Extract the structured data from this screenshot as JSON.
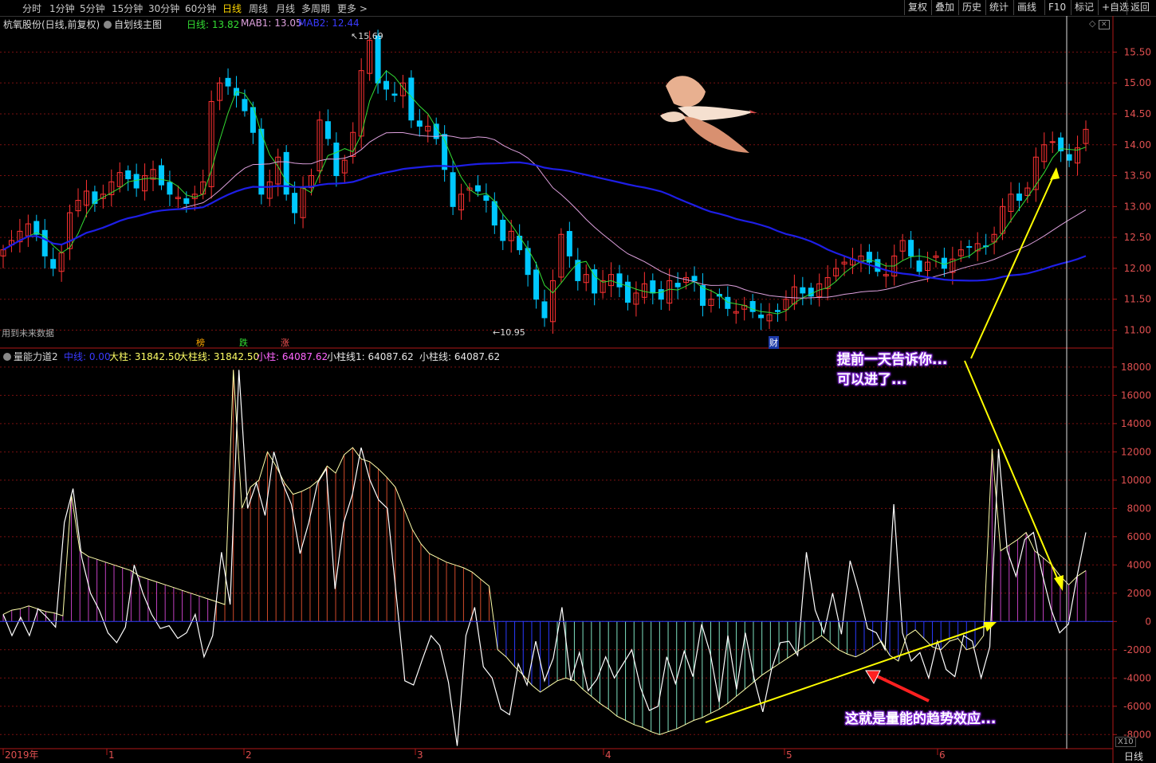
{
  "toolbar": {
    "periods": [
      "分时",
      "1分钟",
      "5分钟",
      "15分钟",
      "30分钟",
      "60分钟",
      "日线",
      "周线",
      "月线",
      "多周期",
      "更多 >"
    ],
    "active_period": "日线",
    "right_buttons": [
      "复权",
      "叠加",
      "历史",
      "统计",
      "画线",
      "F10",
      "标记",
      "+自选",
      "返回"
    ]
  },
  "main_info": {
    "stock": "杭氧股份(日线,前复权)",
    "indicator_name": "自划线主图",
    "day_label": "日线: 13.82",
    "mab1_label": "MAB1: 13.05",
    "mab2_label": "MAB2: 12.44"
  },
  "sub_info": {
    "name": "量能力道2",
    "zhongxian": "中线: 0.00",
    "dazhu": "大柱: 31842.50",
    "dazhuxian": "大柱线: 31842.50",
    "xiaozhu": "小柱: 64087.62",
    "xiaozhuxian1": "小柱线1: 64087.62",
    "xiaozhuxian": "小柱线: 64087.62"
  },
  "labels": {
    "future_data": "用到未来数据",
    "high_mark": "15.69",
    "low_mark": "10.95",
    "tag_bang": "榜",
    "tag_die": "跌",
    "tag_zhang": "涨",
    "tag_cai": "财",
    "x10": "X10",
    "bottom_period": "日线",
    "annotation_top_1": "提前一天告诉你...",
    "annotation_top_2": "可以进了...",
    "annotation_bottom": "这就是量能的趋势效应..."
  },
  "colors": {
    "up": "#ff3232",
    "down": "#00c8ff",
    "ma_fast": "#33dd33",
    "ma_mid": "#dda0dd",
    "ma_slow": "#1e1ee6",
    "grid": "#7a1010",
    "axis": "#b01818",
    "annotation_line": "#ffff00",
    "annotation_arrow": "#ff0000"
  },
  "chart_data": [
    {
      "type": "candlestick",
      "title": "杭氧股份(日线,前复权)",
      "ylim": [
        10.8,
        15.75
      ],
      "y_ticks": [
        11.0,
        11.5,
        12.0,
        12.5,
        13.0,
        13.5,
        14.0,
        14.5,
        15.0,
        15.5
      ],
      "x_ticks": [
        "2019年",
        "1",
        "2",
        "3",
        "4",
        "5",
        "6"
      ],
      "high": 15.69,
      "low": 10.95,
      "close_series": [
        12.3,
        12.45,
        12.6,
        12.72,
        12.55,
        12.2,
        12.0,
        12.25,
        12.9,
        13.1,
        13.25,
        13.05,
        13.2,
        13.4,
        13.55,
        13.45,
        13.3,
        13.5,
        13.6,
        13.35,
        13.2,
        13.15,
        13.05,
        13.2,
        13.4,
        14.7,
        15.0,
        14.95,
        14.8,
        14.55,
        14.2,
        13.2,
        13.4,
        13.8,
        13.2,
        12.9,
        13.3,
        13.5,
        14.4,
        14.1,
        13.5,
        13.75,
        14.2,
        15.2,
        15.69,
        15.0,
        14.9,
        14.8,
        15.0,
        14.4,
        14.3,
        14.3,
        14.1,
        13.6,
        13.0,
        13.2,
        13.3,
        13.25,
        13.1,
        12.7,
        12.45,
        12.6,
        12.3,
        11.9,
        11.5,
        11.2,
        11.8,
        12.55,
        12.2,
        11.8,
        11.9,
        11.6,
        11.8,
        11.9,
        11.7,
        11.45,
        11.6,
        11.75,
        11.6,
        11.5,
        11.8,
        11.7,
        11.85,
        11.8,
        11.4,
        11.5,
        11.55,
        11.35,
        11.3,
        11.4,
        11.3,
        11.2,
        11.25,
        11.3,
        11.5,
        11.7,
        11.6,
        11.55,
        11.75,
        11.85,
        12.0,
        12.1,
        12.15,
        12.2,
        12.1,
        11.95,
        11.9,
        12.2,
        12.45,
        12.2,
        11.95,
        12.1,
        12.2,
        12.0,
        12.15,
        12.3,
        12.35,
        12.4,
        12.35,
        12.55,
        13.0,
        13.2,
        13.1,
        13.3,
        13.8,
        14.0,
        14.05,
        13.9,
        13.75,
        13.95,
        14.25
      ],
      "ma_fast_label": "日线",
      "ma_mid_label": "MAB1",
      "ma_slow_label": "MAB2"
    },
    {
      "type": "bar",
      "title": "量能力道2",
      "ylim": [
        -9000,
        18500
      ],
      "y_ticks": [
        18000,
        16000,
        14000,
        12000,
        10000,
        8000,
        6000,
        4000,
        2000,
        0,
        -2000,
        -4000,
        -6000,
        -8000
      ],
      "values": [
        500,
        800,
        900,
        1100,
        900,
        700,
        600,
        400,
        9000,
        5000,
        4600,
        4400,
        4200,
        4000,
        3800,
        3600,
        3200,
        3000,
        2800,
        2600,
        2400,
        2200,
        2000,
        1800,
        1600,
        1400,
        1200,
        17800,
        8000,
        9500,
        10000,
        12000,
        11000,
        9800,
        9000,
        9200,
        9500,
        10000,
        11000,
        10500,
        11800,
        12300,
        11500,
        11300,
        10800,
        10200,
        9500,
        8000,
        6500,
        5500,
        4800,
        4500,
        4200,
        4000,
        3800,
        3500,
        3000,
        2500,
        -2000,
        -2500,
        -3200,
        -3800,
        -4500,
        -5000,
        -4600,
        -4200,
        -4000,
        -4200,
        -4800,
        -5300,
        -5800,
        -6200,
        -6700,
        -7000,
        -7300,
        -7500,
        -7800,
        -8000,
        -7800,
        -7600,
        -7300,
        -7000,
        -6800,
        -6500,
        -6200,
        -5800,
        -5300,
        -4800,
        -4300,
        -3800,
        -3400,
        -3000,
        -2600,
        -2200,
        -1800,
        -1400,
        -1000,
        -1500,
        -2000,
        -2300,
        -2500,
        -2200,
        -1800,
        -1400,
        -2400,
        -2800,
        -1000,
        -600,
        -1200,
        -1800,
        -2000,
        -1400,
        -1200,
        -2000,
        -1800,
        -1000,
        12200,
        5000,
        5400,
        5800,
        6300,
        5000,
        4500,
        4000,
        3200,
        2600,
        3200,
        3600
      ],
      "line_values": [
        500,
        -1000,
        300,
        -1000,
        900,
        300,
        -400,
        7000,
        9400,
        4500,
        2000,
        800,
        -800,
        -1500,
        -400,
        4000,
        2000,
        500,
        -500,
        -300,
        -1200,
        -800,
        500,
        -2500,
        -1000,
        4900,
        1200,
        17800,
        8000,
        9800,
        7500,
        12000,
        9800,
        8300,
        4800,
        7000,
        9800,
        10800,
        2300,
        7000,
        9000,
        12300,
        10000,
        8600,
        8000,
        2000,
        -4200,
        -4500,
        -2700,
        -1000,
        -1700,
        -4300,
        -8800,
        -1000,
        1000,
        -3200,
        -4000,
        -6200,
        -6600,
        -3000,
        -4500,
        -1400,
        -4200,
        -2600,
        1000,
        -4200,
        -2200,
        -4900,
        -4100,
        -2500,
        -4000,
        -3000,
        -2000,
        -4700,
        -6300,
        -6000,
        -2500,
        -4400,
        -2100,
        -3900,
        -200,
        -2300,
        -5700,
        -1000,
        -4800,
        -800,
        -4000,
        -6400,
        -3400,
        -1500,
        -1400,
        -2400,
        4900,
        800,
        -800,
        2000,
        -900,
        4300,
        2100,
        -500,
        -800,
        -2000,
        8300,
        -800,
        -2800,
        -2200,
        -4000,
        -1400,
        -3400,
        -3900,
        -1000,
        -1400,
        -4000,
        -1800,
        12200,
        5000,
        3200,
        5800,
        6300,
        3400,
        900,
        -800,
        -200,
        3200,
        6300
      ]
    }
  ]
}
